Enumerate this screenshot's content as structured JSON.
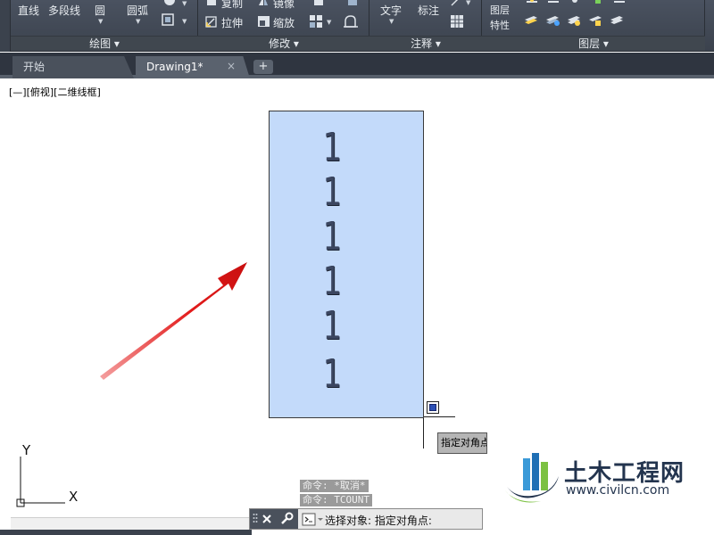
{
  "ribbon": {
    "draw": {
      "line": "直线",
      "polyline": "多段线",
      "circle": "圆",
      "arc": "圆弧",
      "title": "绘图"
    },
    "modify": {
      "copy": "复制",
      "mirror": "镜像",
      "stretch": "拉伸",
      "scale": "缩放",
      "title": "修改"
    },
    "annotation": {
      "text": "文字",
      "dimension": "标注",
      "title": "注释"
    },
    "layers": {
      "properties_line1": "图层",
      "properties_line2": "特性",
      "title": "图层"
    }
  },
  "tabs": [
    {
      "label": "开始"
    },
    {
      "label": "Drawing1*"
    }
  ],
  "tab_close": "×",
  "tab_add": "+",
  "viewport_label": "[—][俯视][二维线框]",
  "drawing": {
    "digits": [
      "1",
      "1",
      "1",
      "1",
      "1",
      "1"
    ]
  },
  "tooltip": "指定对角点",
  "ucs": {
    "x_label": "X",
    "y_label": "Y"
  },
  "command_history": [
    "命令: *取消*",
    "命令: TCOUNT"
  ],
  "command_line": {
    "prompt": "选择对象: 指定对角点:"
  },
  "watermark": {
    "title": "土木工程网",
    "url": "www.civilcn.com"
  },
  "colors": {
    "selection_fill": "#c3dafa",
    "ribbon_bg": "#3b424d",
    "arrow": "#e31b1b"
  }
}
